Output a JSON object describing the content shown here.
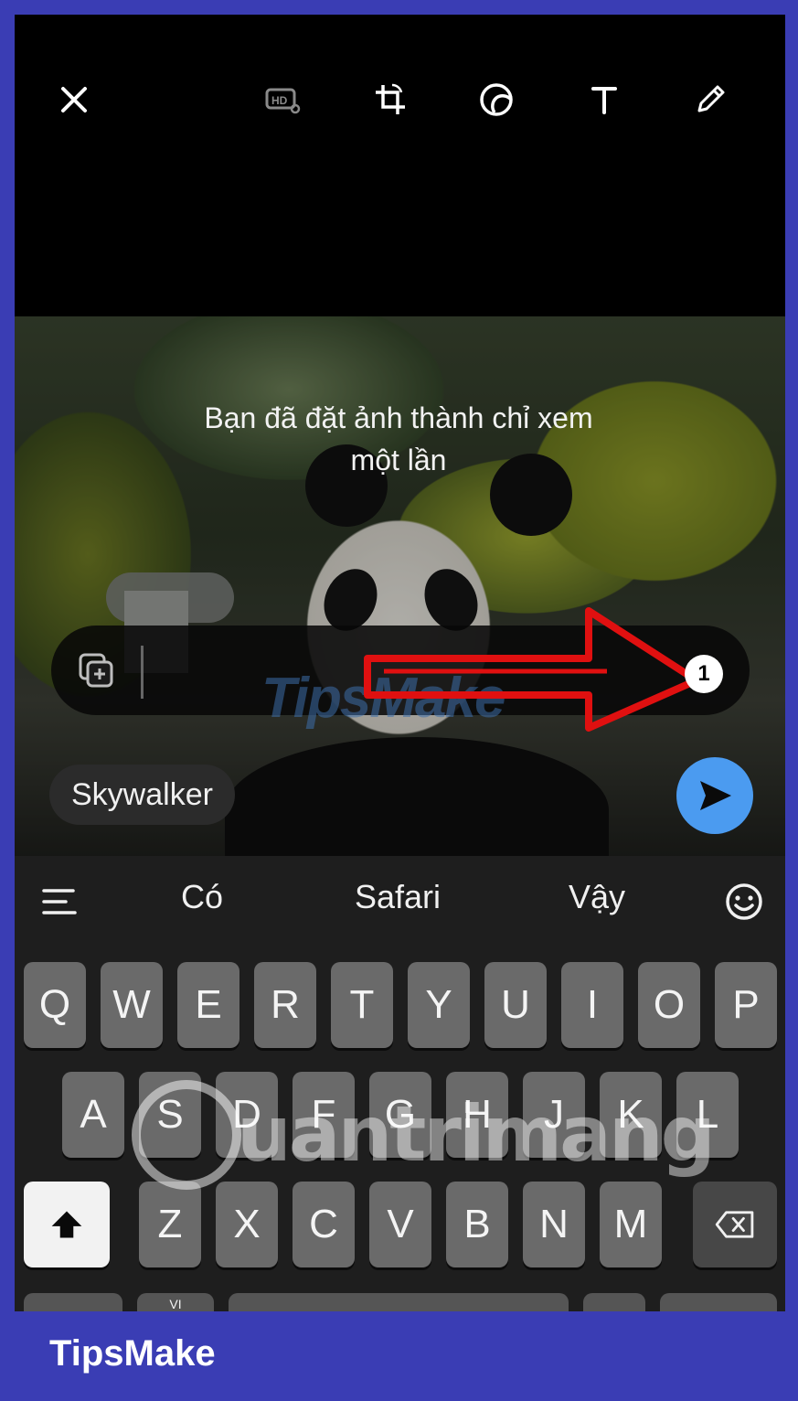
{
  "overlay": {
    "message_line1": "Bạn đã đặt ảnh thành chỉ xem",
    "message_line2": "một lần"
  },
  "caption": {
    "value": "",
    "view_once_badge": "1",
    "watermark": "TipsMake"
  },
  "recipient": {
    "name": "Skywalker"
  },
  "suggestions": [
    "Có",
    "Safari",
    "Vậy"
  ],
  "keyboard": {
    "row1": [
      "Q",
      "W",
      "E",
      "R",
      "T",
      "Y",
      "U",
      "I",
      "O",
      "P"
    ],
    "row2": [
      "A",
      "S",
      "D",
      "F",
      "G",
      "H",
      "J",
      "K",
      "L"
    ],
    "row3": [
      "Z",
      "X",
      "C",
      "V",
      "B",
      "N",
      "M"
    ],
    "lang_hint": "VI"
  },
  "watermark2": {
    "text": "uantrimang"
  },
  "footer": {
    "brand": "TipsMake"
  },
  "colors": {
    "send_button": "#4b9bf0",
    "annotation_arrow": "#e01010",
    "frame_border": "#3a3db4"
  },
  "icons": {
    "close": "close-icon",
    "hd": "hd-icon",
    "crop": "crop-rotate-icon",
    "sticker": "sticker-icon",
    "text": "text-icon",
    "draw": "pencil-icon",
    "add_media": "add-media-icon",
    "send": "send-icon",
    "menu": "menu-lines-icon",
    "emoji": "emoji-icon",
    "shift": "shift-icon",
    "backspace": "backspace-icon"
  }
}
